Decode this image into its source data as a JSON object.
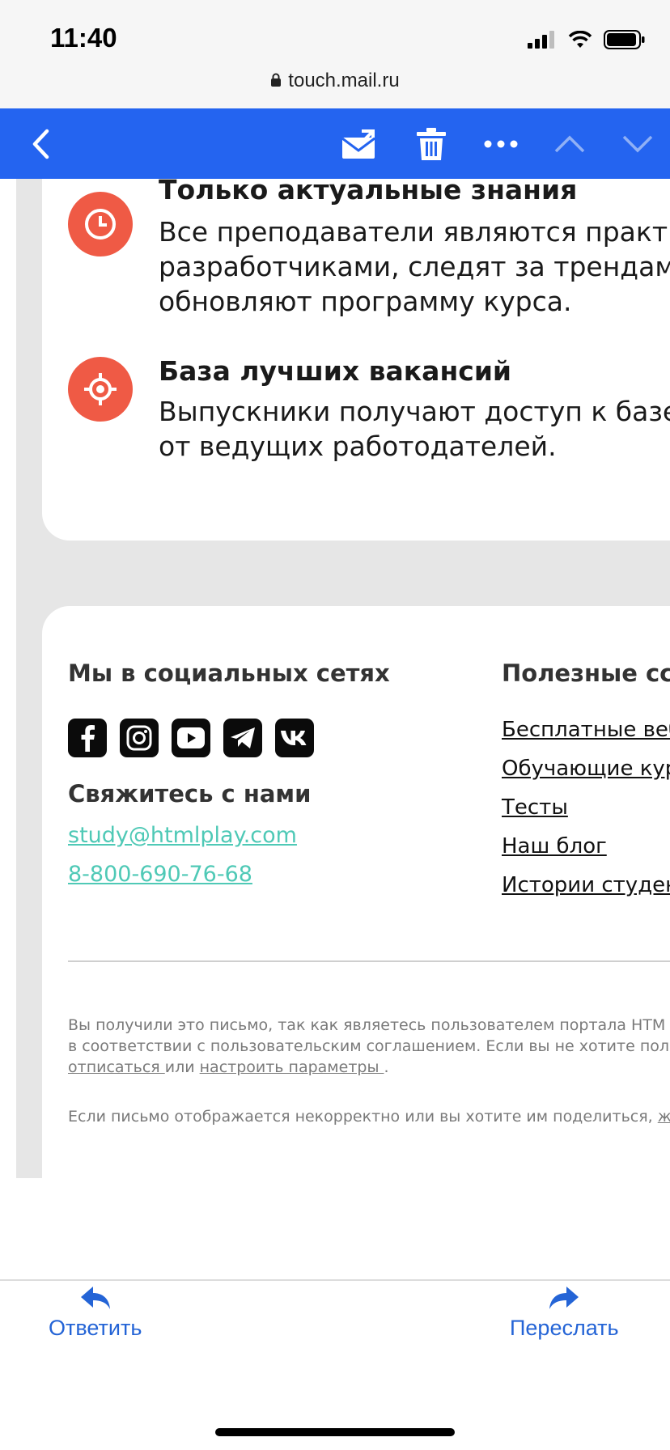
{
  "status": {
    "time": "11:40",
    "url": "touch.mail.ru"
  },
  "colors": {
    "toolbar": "#2464f0",
    "accent_orange": "#ef5a45",
    "link_teal": "#4fc9b6",
    "action_blue": "#2464d6"
  },
  "features": [
    {
      "icon": "clock-icon",
      "title": "Только актуальные знания",
      "lines": [
        "Все преподаватели являются практикт",
        "разработчиками, следят за трендами",
        "обновляют программу курса."
      ]
    },
    {
      "icon": "target-icon",
      "title": "База лучших вакансий",
      "lines": [
        "Выпускники получают доступ к базе в",
        "от ведущих работодателей."
      ]
    }
  ],
  "footer": {
    "social_title": "Мы в социальных сетях",
    "social_icons": [
      "facebook-icon",
      "instagram-icon",
      "youtube-icon",
      "telegram-icon",
      "vk-icon"
    ],
    "contact_title": "Свяжитесь с нами",
    "email": "study@htmlplay.com",
    "phone": "8-800-690-76-68",
    "links_title": "Полезные ссь",
    "links": [
      "Бесплатные веб",
      "Обучающие курс",
      "Тесты",
      "Наш блог",
      "Истории студент"
    ],
    "disclaimer_line1": "Вы получили это письмо, так как являетесь пользователем портала HTM",
    "disclaimer_line2": "в соответствии с пользовательским соглашением. Если вы не хотите пол",
    "unsubscribe": "отписаться ",
    "or": "или",
    "settings": "настроить параметры ",
    "period": ".",
    "web_version_text": "Если письмо отображается некорректно или вы хотите им поделиться,",
    "web_version_link": "ж"
  },
  "actions": {
    "reply": "Ответить",
    "forward": "Переслать"
  }
}
